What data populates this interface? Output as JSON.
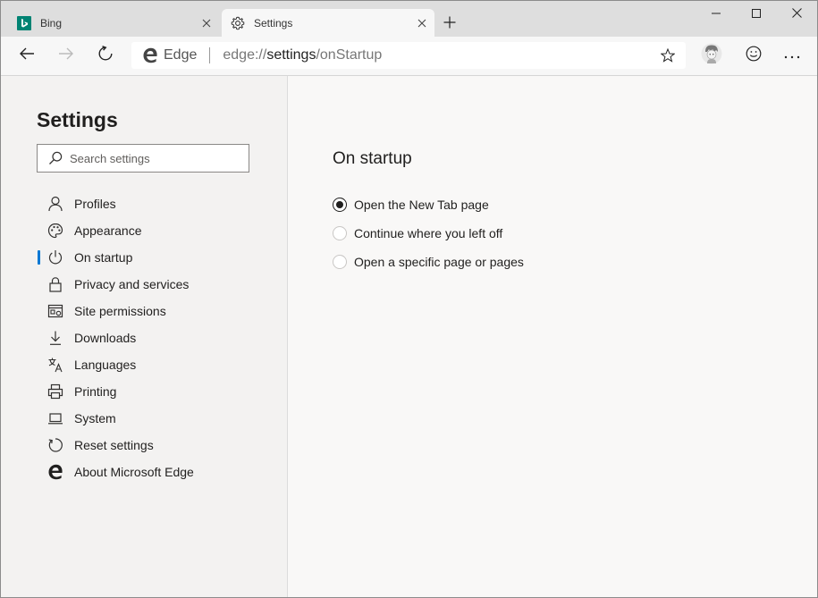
{
  "tabs": [
    {
      "title": "Bing",
      "icon": "bing-logo-icon",
      "active": false
    },
    {
      "title": "Settings",
      "icon": "gear-icon",
      "active": true
    }
  ],
  "window_controls": {
    "minimize": "minimize-icon",
    "maximize": "maximize-icon",
    "close": "close-icon"
  },
  "omnibox": {
    "site_label": "Edge",
    "url_scheme": "edge://",
    "url_host": "settings",
    "url_path": "/onStartup"
  },
  "sidebar": {
    "title": "Settings",
    "search_placeholder": "Search settings",
    "items": [
      {
        "label": "Profiles",
        "icon": "person-icon"
      },
      {
        "label": "Appearance",
        "icon": "palette-icon"
      },
      {
        "label": "On startup",
        "icon": "power-icon",
        "selected": true
      },
      {
        "label": "Privacy and services",
        "icon": "lock-icon"
      },
      {
        "label": "Site permissions",
        "icon": "site-permissions-icon"
      },
      {
        "label": "Downloads",
        "icon": "download-icon"
      },
      {
        "label": "Languages",
        "icon": "languages-icon"
      },
      {
        "label": "Printing",
        "icon": "printer-icon"
      },
      {
        "label": "System",
        "icon": "laptop-icon"
      },
      {
        "label": "Reset settings",
        "icon": "reset-icon"
      },
      {
        "label": "About Microsoft Edge",
        "icon": "edge-logo-icon"
      }
    ]
  },
  "main": {
    "section_title": "On startup",
    "options": [
      {
        "label": "Open the New Tab page",
        "checked": true
      },
      {
        "label": "Continue where you left off",
        "checked": false
      },
      {
        "label": "Open a specific page or pages",
        "checked": false
      }
    ]
  },
  "colors": {
    "accent": "#0078d4",
    "bing_teal": "#008373",
    "sidebar_bg": "#f3f2f1",
    "content_bg": "#f9f8f7"
  }
}
